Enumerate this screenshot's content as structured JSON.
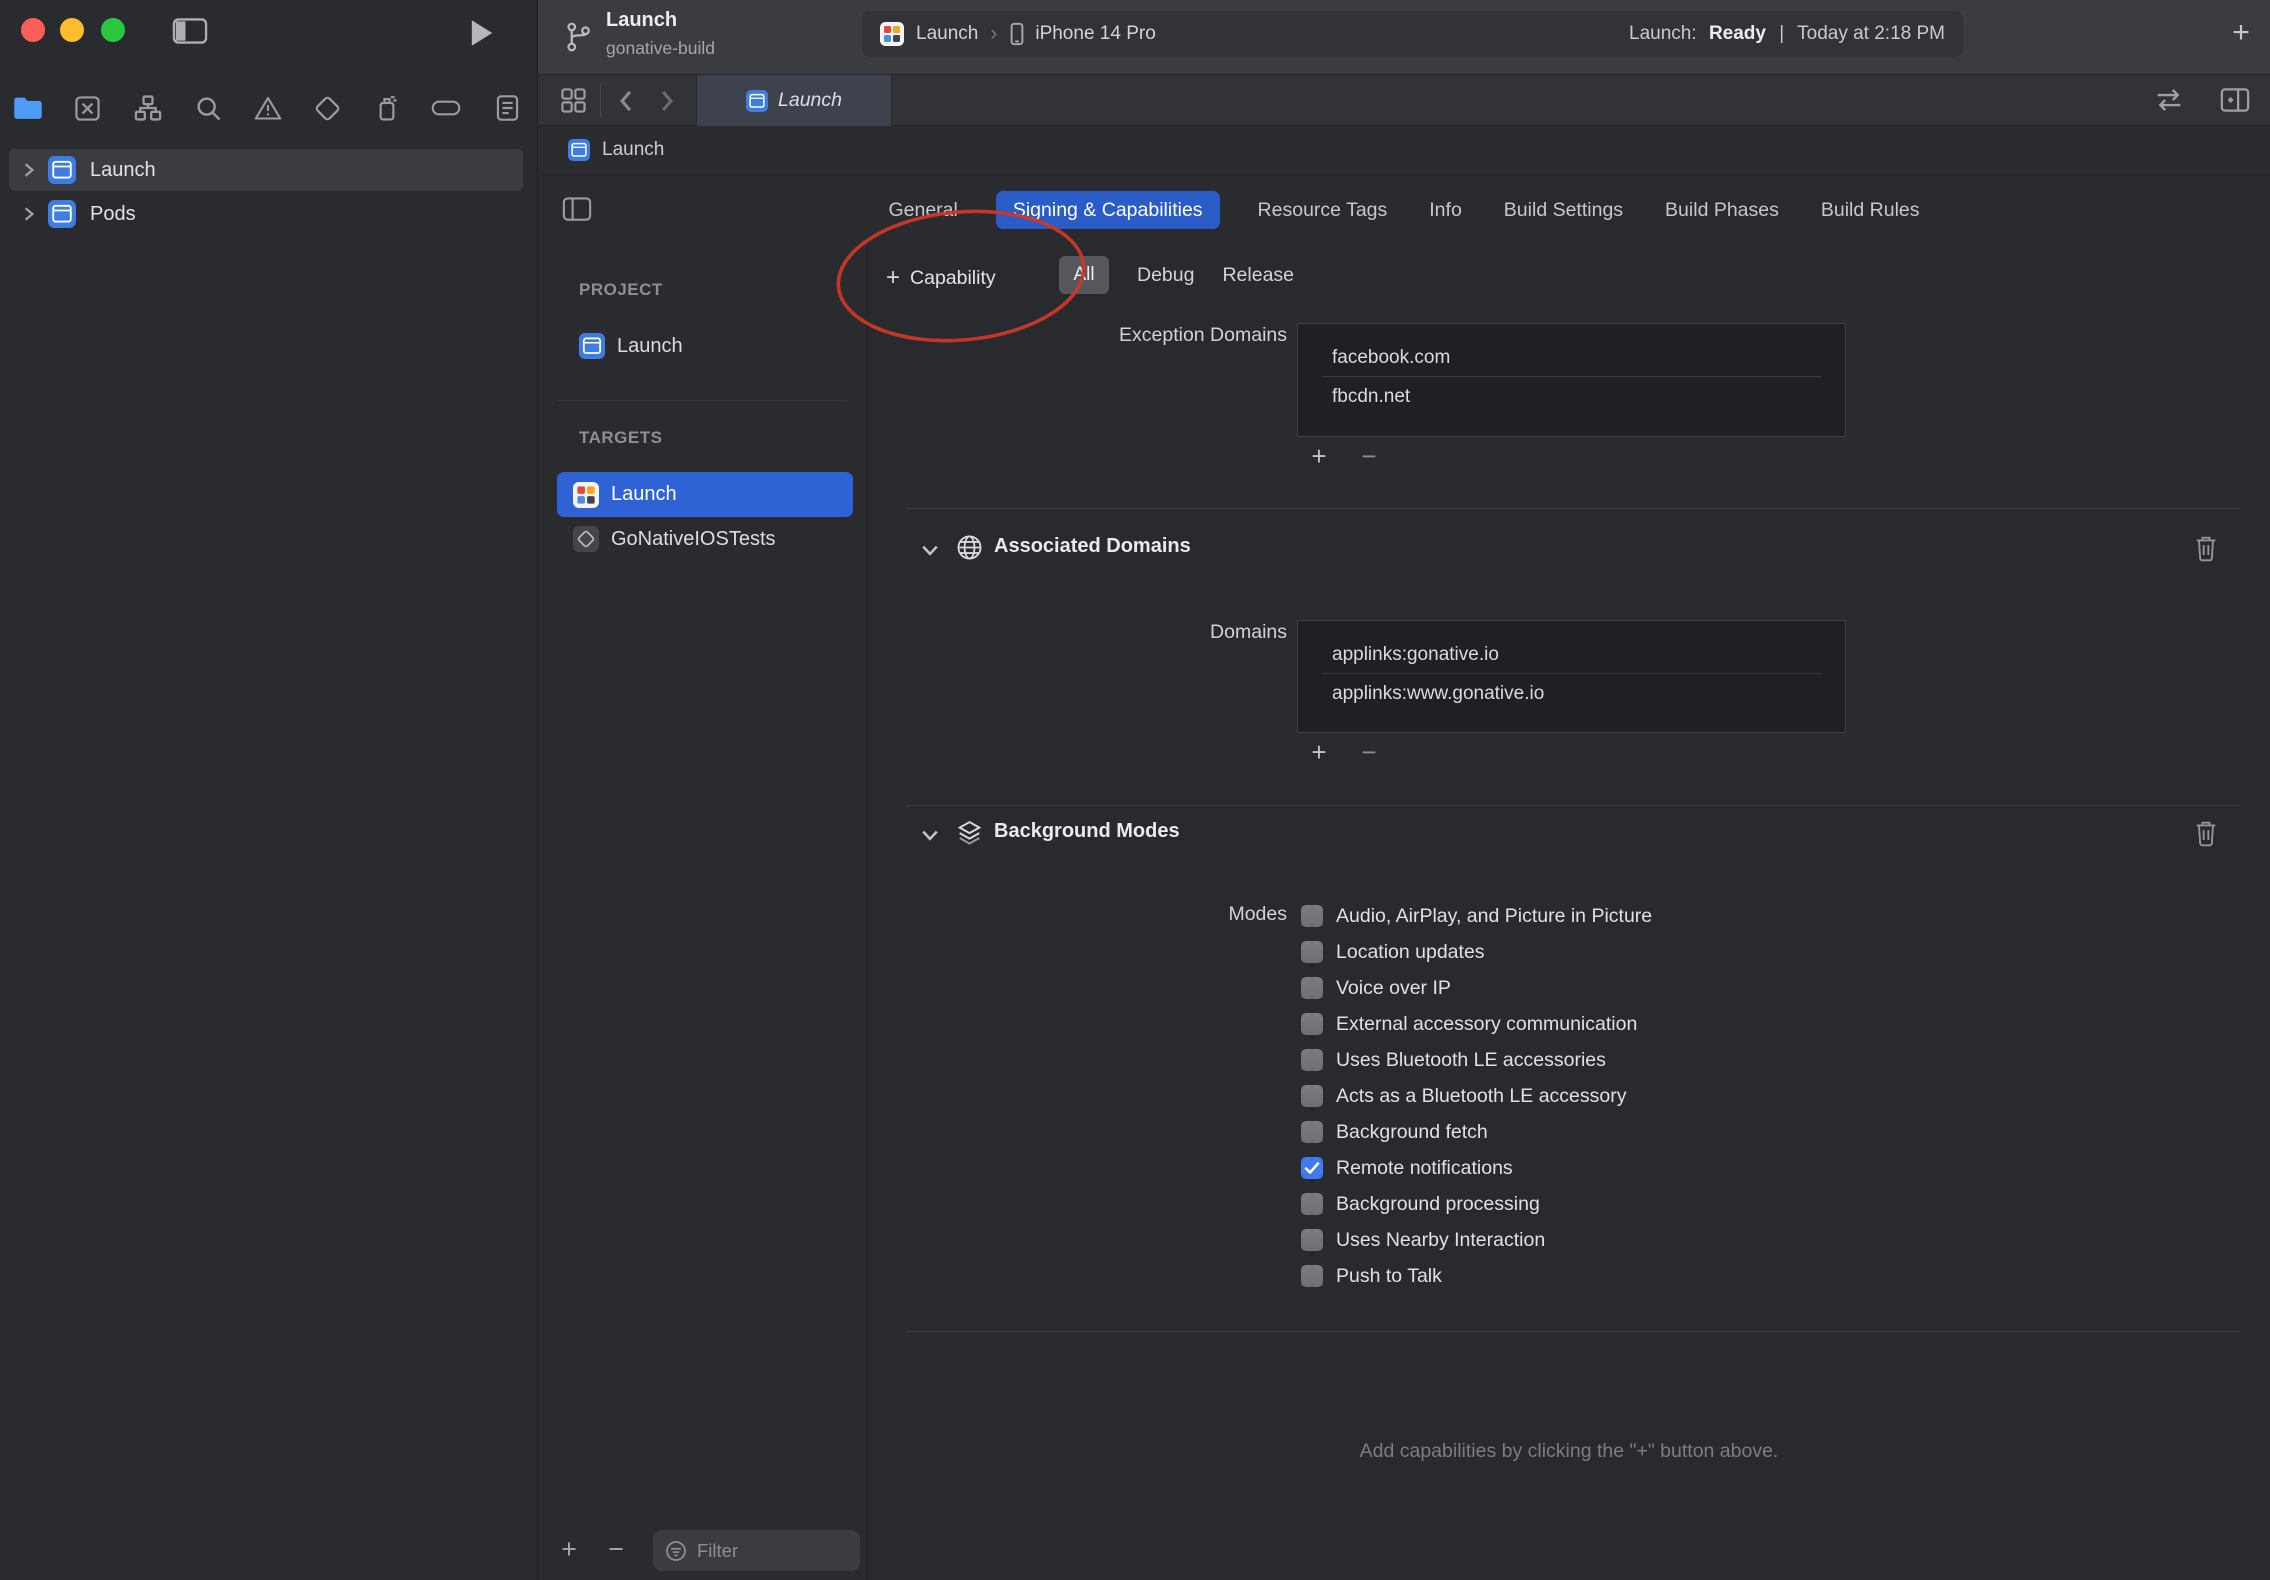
{
  "icons": {
    "plus": "+",
    "minus": "−",
    "breadcrumb_separator": "›",
    "status_separator": "|"
  },
  "toolbar": {
    "project": "Launch",
    "subtitle": "gonative-build",
    "run_target": "Launch",
    "device": "iPhone 14 Pro",
    "status_label": "Launch:",
    "status_value": "Ready",
    "status_time": "Today at 2:18 PM"
  },
  "tab_bar": {
    "active_tab": "Launch"
  },
  "jump_bar": {
    "current": "Launch"
  },
  "navigator": {
    "items": [
      {
        "label": "Launch"
      },
      {
        "label": "Pods"
      }
    ]
  },
  "project_editor": {
    "project_header": "PROJECT",
    "project_name": "Launch",
    "targets_header": "TARGETS",
    "targets": [
      {
        "label": "Launch"
      },
      {
        "label": "GoNativeIOSTests"
      }
    ],
    "filter_placeholder": "Filter"
  },
  "editor_tabs": [
    "General",
    "Signing & Capabilities",
    "Resource Tags",
    "Info",
    "Build Settings",
    "Build Phases",
    "Build Rules"
  ],
  "capability_bar": {
    "button": "Capability",
    "segments": [
      "All",
      "Debug",
      "Release"
    ]
  },
  "content": {
    "exception_domains": {
      "label": "Exception Domains",
      "rows": [
        "facebook.com",
        "fbcdn.net"
      ]
    },
    "associated_domains": {
      "title": "Associated Domains",
      "label": "Domains",
      "rows": [
        "applinks:gonative.io",
        "applinks:www.gonative.io"
      ]
    },
    "background_modes": {
      "title": "Background Modes",
      "label": "Modes",
      "modes": [
        {
          "label": "Audio, AirPlay, and Picture in Picture",
          "checked": false
        },
        {
          "label": "Location updates",
          "checked": false
        },
        {
          "label": "Voice over IP",
          "checked": false
        },
        {
          "label": "External accessory communication",
          "checked": false
        },
        {
          "label": "Uses Bluetooth LE accessories",
          "checked": false
        },
        {
          "label": "Acts as a Bluetooth LE accessory",
          "checked": false
        },
        {
          "label": "Background fetch",
          "checked": false
        },
        {
          "label": "Remote notifications",
          "checked": true
        },
        {
          "label": "Background processing",
          "checked": false
        },
        {
          "label": "Uses Nearby Interaction",
          "checked": false
        },
        {
          "label": "Push to Talk",
          "checked": false
        }
      ]
    },
    "hint": "Add capabilities by clicking the \"+\" button above."
  },
  "colors": {
    "accent_blue": "#2f62d4",
    "tab_pill_blue": "#2a5cc7",
    "checked_blue": "#3d7bf5",
    "annotation_red": "#cb3728"
  }
}
